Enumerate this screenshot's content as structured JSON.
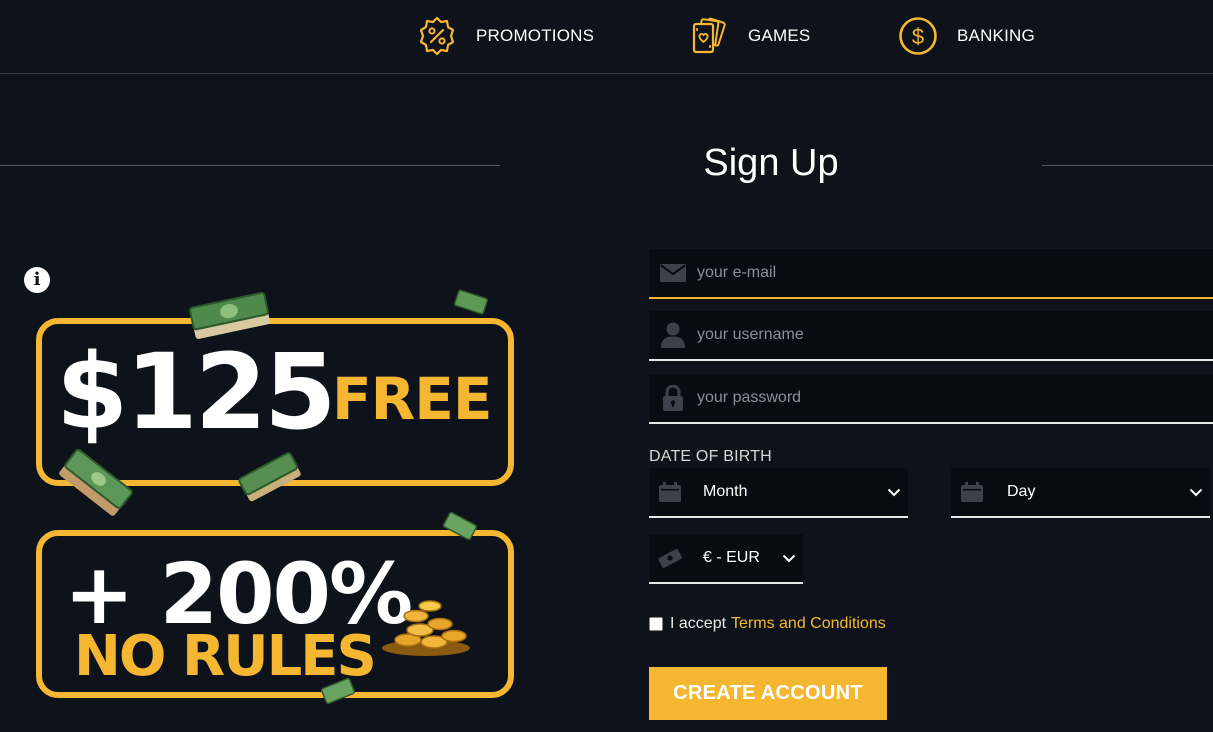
{
  "nav": {
    "promotions": {
      "label": "PROMOTIONS",
      "icon": "percent-badge-icon"
    },
    "games": {
      "label": "GAMES",
      "icon": "playing-cards-icon"
    },
    "banking": {
      "label": "BANKING",
      "icon": "dollar-coin-icon"
    }
  },
  "page": {
    "title": "Sign Up"
  },
  "promo": {
    "amount": "$125",
    "free": "FREE",
    "percent": "+ 200%",
    "no_rules": "NO RULES"
  },
  "form": {
    "email_placeholder": "your e-mail",
    "username_placeholder": "your username",
    "password_placeholder": "your password",
    "dob_label": "DATE OF BIRTH",
    "month_value": "Month",
    "day_value": "Day",
    "currency_value": "€ - EUR",
    "terms_prefix": "I accept",
    "terms_link": "Terms and Conditions",
    "submit_label": "CREATE ACCOUNT"
  },
  "colors": {
    "background": "#0e121a",
    "accent": "#f5b731",
    "field_bg": "#080c12"
  }
}
